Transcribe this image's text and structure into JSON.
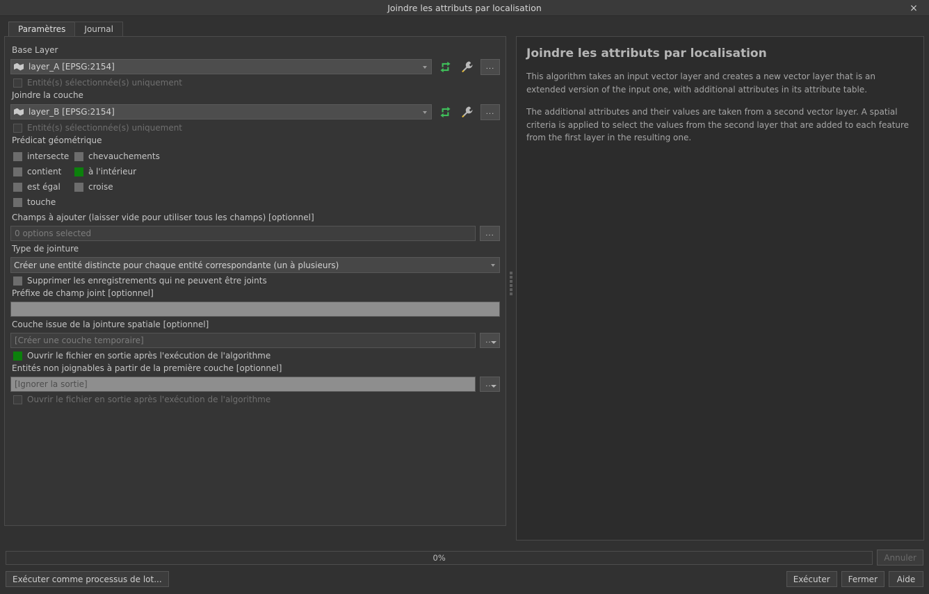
{
  "window": {
    "title": "Joindre les attributs par localisation",
    "close_label": "×"
  },
  "tabs": [
    {
      "label": "Paramètres",
      "active": true
    },
    {
      "label": "Journal",
      "active": false
    }
  ],
  "form": {
    "base_layer_label": "Base Layer",
    "base_layer_value": "layer_A [EPSG:2154]",
    "base_selected_only_label": "Entité(s) sélectionnée(s) uniquement",
    "join_layer_label": "Joindre la couche",
    "join_layer_value": "layer_B [EPSG:2154]",
    "join_selected_only_label": "Entité(s) sélectionnée(s) uniquement",
    "predicate_label": "Prédicat géométrique",
    "predicates": [
      {
        "label": "intersecte",
        "checked": false
      },
      {
        "label": "chevauchements",
        "checked": false
      },
      {
        "label": "contient",
        "checked": false
      },
      {
        "label": "à l'intérieur",
        "checked": true
      },
      {
        "label": "est égal",
        "checked": false
      },
      {
        "label": "croise",
        "checked": false
      },
      {
        "label": "touche",
        "checked": false
      }
    ],
    "fields_to_add_label": "Champs à ajouter (laisser vide pour utiliser tous les champs) [optionnel]",
    "fields_to_add_value": "0 options selected",
    "join_type_label": "Type de jointure",
    "join_type_value": "Créer une entité distincte pour chaque entité correspondante (un à plusieurs)",
    "discard_label": "Supprimer les enregistrements qui ne peuvent être joints",
    "discard_checked": false,
    "prefix_label": "Préfixe de champ joint [optionnel]",
    "prefix_value": "",
    "output_layer_label": "Couche issue de la jointure spatiale [optionnel]",
    "output_layer_value": "[Créer une couche temporaire]",
    "open_output_label": "Ouvrir le fichier en sortie après l'exécution de l'algorithme",
    "open_output_checked": true,
    "non_matching_label": "Entités non joignables à partir de la première couche [optionnel]",
    "non_matching_value": "[Ignorer la sortie]",
    "open_output2_label": "Ouvrir le fichier en sortie après l'exécution de l'algorithme",
    "open_output2_checked": false,
    "dots_label": "..."
  },
  "help": {
    "title": "Joindre les attributs par localisation",
    "paragraph1": "This algorithm takes an input vector layer and creates a new vector layer that is an extended version of the input one, with additional attributes in its attribute table.",
    "paragraph2": "The additional attributes and their values are taken from a second vector layer. A spatial criteria is applied to select the values from the second layer that are added to each feature from the first layer in the resulting one."
  },
  "bottom": {
    "progress_text": "0%",
    "progress_percent": 0,
    "cancel_label": "Annuler",
    "batch_label": "Exécuter comme processus de lot...",
    "run_label": "Exécuter",
    "close_label": "Fermer",
    "help_label": "Aide"
  },
  "icons": {
    "refresh": "iterate-icon",
    "wrench": "wrench-icon",
    "layer": "polygon-layer-icon"
  }
}
